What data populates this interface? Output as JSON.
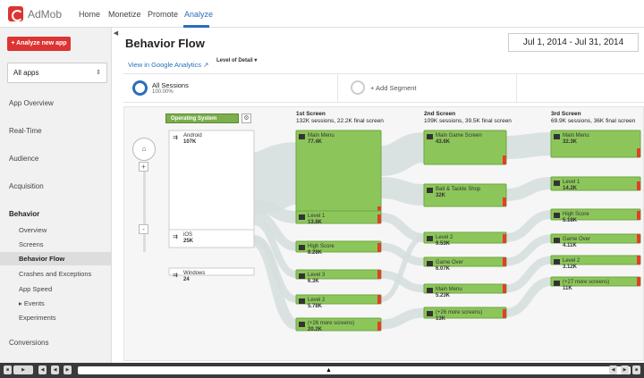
{
  "topbar": {
    "brand": "AdMob",
    "nav": [
      "Home",
      "Monetize",
      "Promote",
      "Analyze"
    ],
    "active_nav": "Analyze"
  },
  "sidebar": {
    "new_app_label": "+ Analyze new app",
    "app_select_value": "All apps",
    "items": {
      "app_overview": "App Overview",
      "real_time": "Real-Time",
      "audience": "Audience",
      "acquisition": "Acquisition",
      "behavior": "Behavior",
      "overview": "Overview",
      "screens": "Screens",
      "behavior_flow": "Behavior Flow",
      "crashes": "Crashes and Exceptions",
      "app_speed": "App Speed",
      "events": "▸ Events",
      "experiments": "Experiments",
      "conversions": "Conversions"
    }
  },
  "main": {
    "title": "Behavior Flow",
    "date_range": "Jul 1, 2014 - Jul 31, 2014",
    "ga_link": "View in Google Analytics",
    "level_of_detail": "Level of Detail ▾",
    "segment_name": "All Sessions",
    "segment_pct": "100.00%",
    "add_segment": "+ Add Segment"
  },
  "flow": {
    "dimension": "Operating System",
    "columns": [
      {
        "title": "1st Screen",
        "sub": "132K sessions, 22.2K final screen"
      },
      {
        "title": "2nd Screen",
        "sub": "109K sessions, 39.5K final screen"
      },
      {
        "title": "3rd Screen",
        "sub": "69.9K sessions, 36K final screen"
      }
    ],
    "os_nodes": [
      {
        "name": "Android",
        "value": "107K"
      },
      {
        "name": "iOS",
        "value": "25K"
      },
      {
        "name": "Windows",
        "value": "24"
      }
    ],
    "col1": [
      {
        "name": "Main Menu",
        "value": "77.4K"
      },
      {
        "name": "Level 1",
        "value": "13.8K"
      },
      {
        "name": "High Score",
        "value": "8.28K"
      },
      {
        "name": "Level 3",
        "value": "6.3K"
      },
      {
        "name": "Level 2",
        "value": "5.78K"
      },
      {
        "name": "(+26 more screens)",
        "value": "20.2K"
      }
    ],
    "col2": [
      {
        "name": "Main Game Screen",
        "value": "43.6K"
      },
      {
        "name": "Bait & Tackle Shop",
        "value": "32K"
      },
      {
        "name": "Level 2",
        "value": "9.53K"
      },
      {
        "name": "Game Over",
        "value": "6.07K"
      },
      {
        "name": "Main Menu",
        "value": "5.23K"
      },
      {
        "name": "(+26 more screens)",
        "value": "13K"
      }
    ],
    "col3": [
      {
        "name": "Main Menu",
        "value": "32.3K"
      },
      {
        "name": "Level 1",
        "value": "14.2K"
      },
      {
        "name": "High Score",
        "value": "5.18K"
      },
      {
        "name": "Game Over",
        "value": "4.11K"
      },
      {
        "name": "Level 2",
        "value": "3.12K"
      },
      {
        "name": "(+27 more screens)",
        "value": "11K"
      }
    ]
  },
  "colors": {
    "accent": "#2a6ebb",
    "brand_red": "#dd3333",
    "node_green": "#8cc65a",
    "dropoff_red": "#e0402a"
  }
}
